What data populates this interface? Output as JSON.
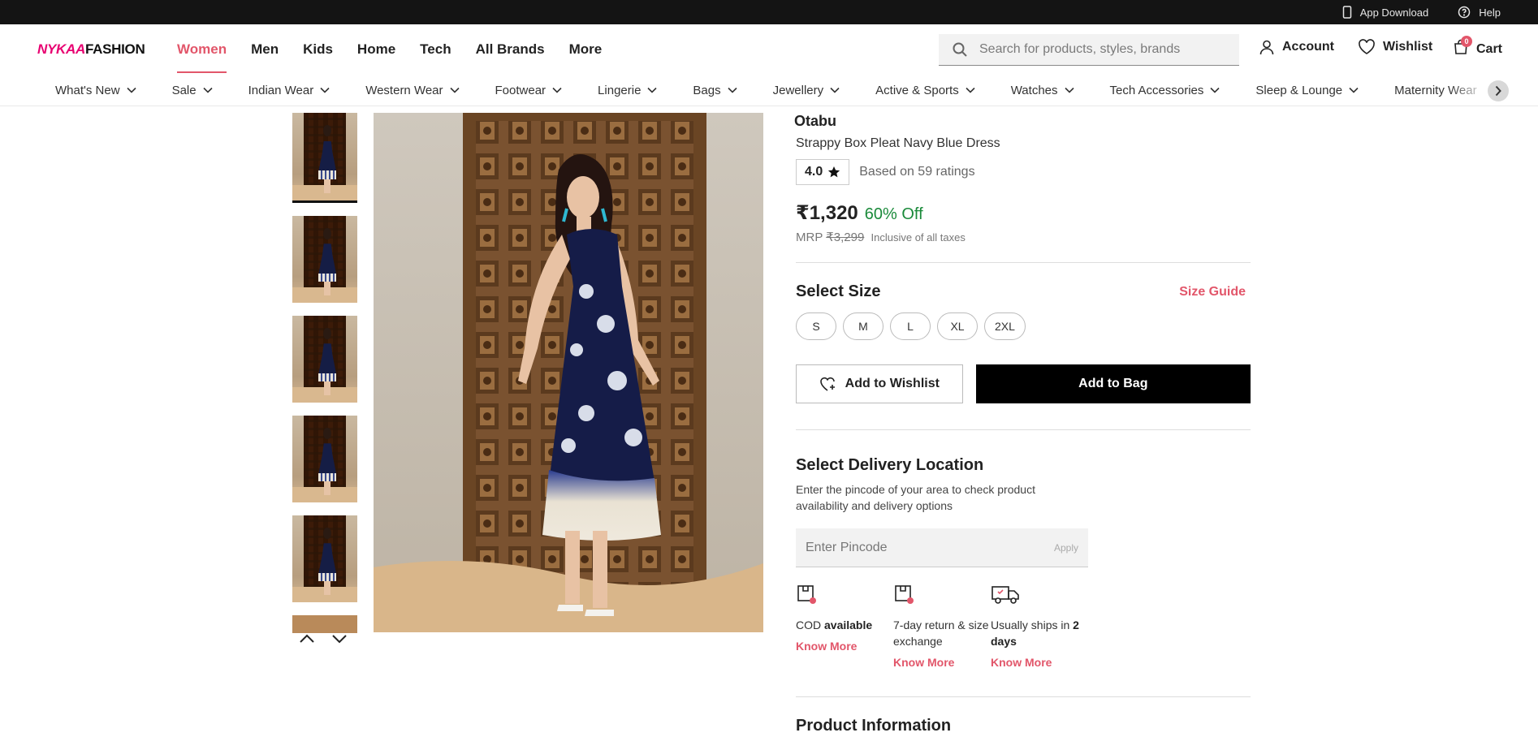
{
  "utility": {
    "app_download": "App Download",
    "help": "Help"
  },
  "header": {
    "logo_part1": "NYKAA",
    "logo_part2": "FASHION",
    "nav": [
      "Women",
      "Men",
      "Kids",
      "Home",
      "Tech",
      "All Brands",
      "More"
    ],
    "active_nav": "Women",
    "search_placeholder": "Search for products, styles, brands",
    "account": "Account",
    "wishlist": "Wishlist",
    "cart": "Cart",
    "cart_count": "0"
  },
  "categories": [
    "What's New",
    "Sale",
    "Indian Wear",
    "Western Wear",
    "Footwear",
    "Lingerie",
    "Bags",
    "Jewellery",
    "Active & Sports",
    "Watches",
    "Tech Accessories",
    "Sleep & Lounge",
    "Maternity Wear"
  ],
  "product": {
    "brand": "Otabu",
    "name": "Strappy Box Pleat Navy Blue Dress",
    "rating": "4.0",
    "rating_count": "Based on 59 ratings",
    "price": "₹1,320",
    "discount": "60% Off",
    "mrp_label": "MRP",
    "mrp_value": "₹3,299",
    "tax_note": "Inclusive of all taxes",
    "select_size": "Select Size",
    "size_guide": "Size Guide",
    "sizes": [
      "S",
      "M",
      "L",
      "XL",
      "2XL"
    ],
    "add_to_wishlist": "Add to Wishlist",
    "add_to_bag": "Add to Bag"
  },
  "delivery": {
    "title": "Select Delivery Location",
    "subtitle": "Enter the pincode of your area to check product availability and delivery options",
    "pincode_placeholder": "Enter Pincode",
    "apply": "Apply",
    "features": [
      {
        "text_a": "COD ",
        "text_b": "available",
        "text_c": "",
        "link": "Know More"
      },
      {
        "text_a": "7-day return & size exchange",
        "text_b": "",
        "text_c": "",
        "link": "Know More"
      },
      {
        "text_a": "Usually ships in ",
        "text_b": "2 days",
        "text_c": "",
        "link": "Know More"
      }
    ]
  },
  "product_information_title": "Product Information",
  "colors": {
    "accent": "#e2566a",
    "discount": "#1a8a3a",
    "topbar": "#141414"
  }
}
